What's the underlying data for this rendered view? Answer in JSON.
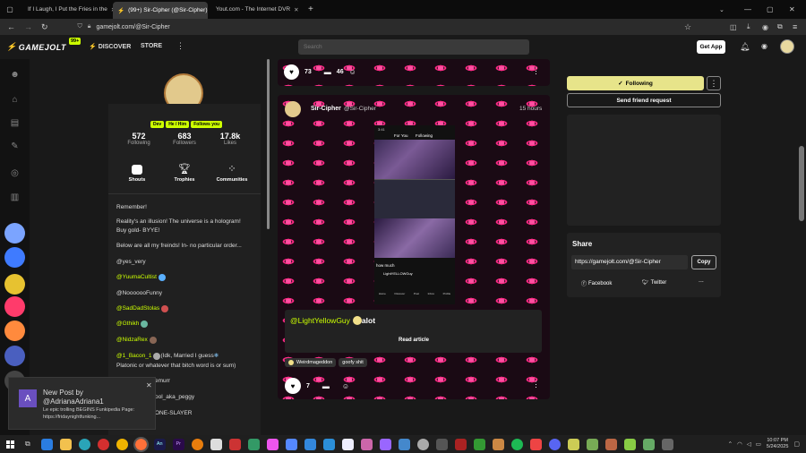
{
  "tabs": [
    {
      "title": "If I Laugh, I Put the Fries in the",
      "active": false
    },
    {
      "title": "(99+) Sir-Cipher (@Sir-Cipher)",
      "active": true
    },
    {
      "title": "Yout.com - The Internet DVR",
      "active": false
    }
  ],
  "new_tab_label": "+",
  "address": "gamejolt.com/@Sir-Cipher",
  "gj": {
    "logo": "GAMEJOLT",
    "badge": "99+",
    "nav": [
      "DISCOVER",
      "STORE"
    ],
    "search_placeholder": "Search",
    "get_app": "Get App"
  },
  "profile": {
    "tags": [
      "Dev",
      "He / Him",
      "Follows you"
    ],
    "stats": [
      {
        "value": "572",
        "label": "Following"
      },
      {
        "value": "683",
        "label": "Followers"
      },
      {
        "value": "17.8k",
        "label": "Likes"
      }
    ],
    "sections": [
      "Shouts",
      "Trophies",
      "Communities"
    ],
    "bio_lines": [
      "Remember!",
      "Reality's an illusion! The universe is a hologram!",
      "Buy gold- BYYE!",
      "Below are all my freinds! In- no particular order..."
    ],
    "friends": [
      "@yes_very",
      "@YuumaCultist",
      "@NooooooFunny",
      "@SadDadStolas",
      "@Gthikh",
      "@NidzaRex"
    ],
    "bacon_user": "@1_Bacon_1",
    "bacon_note_1": " (Idk, Married I guess ",
    "bacon_note_2": "Platonic or whatever that bitch word is or sum)",
    "partial_friends": [
      "emurr",
      "ool_aka_peggy",
      "ONE-SLAYER"
    ]
  },
  "post_top": {
    "likes": "73",
    "comments": "46"
  },
  "post": {
    "author": "Sir-Cipher",
    "handle": "@Sir-Cipher",
    "time": "15 hours",
    "mention": "@LightYellowGuy",
    "text": " alot",
    "read_article": "Read article",
    "tags": [
      "Weirdmageddon",
      "goofy shit"
    ],
    "likes": "7",
    "phone": {
      "status": "3:41",
      "tab_for_you": "For You",
      "tab_following": "Following",
      "caption": "how much",
      "user": "LightYELLOWGuy",
      "nav": [
        "Home",
        "Discover",
        "Post",
        "Inbox",
        "Profile"
      ]
    }
  },
  "right": {
    "following_label": "Following",
    "send_request": "Send friend request",
    "share_title": "Share",
    "share_url": "https://gamejolt.com/@Sir-Cipher",
    "copy_label": "Copy",
    "facebook": "Facebook",
    "twitter": "Twitter",
    "more": "..."
  },
  "notification": {
    "avatar_letter": "A",
    "title": "New Post by",
    "user": "@AdrianaAdriana1",
    "line1": "Le epic trolling BEGINS Funkipedia Page:",
    "line2": "https://fridaynightfunking..."
  },
  "taskbar": {
    "time": "10:07 PM",
    "date": "5/24/2025",
    "app_labels": [
      "An",
      "Pr"
    ]
  },
  "colors": {
    "accent": "#ccff00",
    "following_btn": "#e7e48a",
    "pattern_pink": "#ff2a86"
  }
}
